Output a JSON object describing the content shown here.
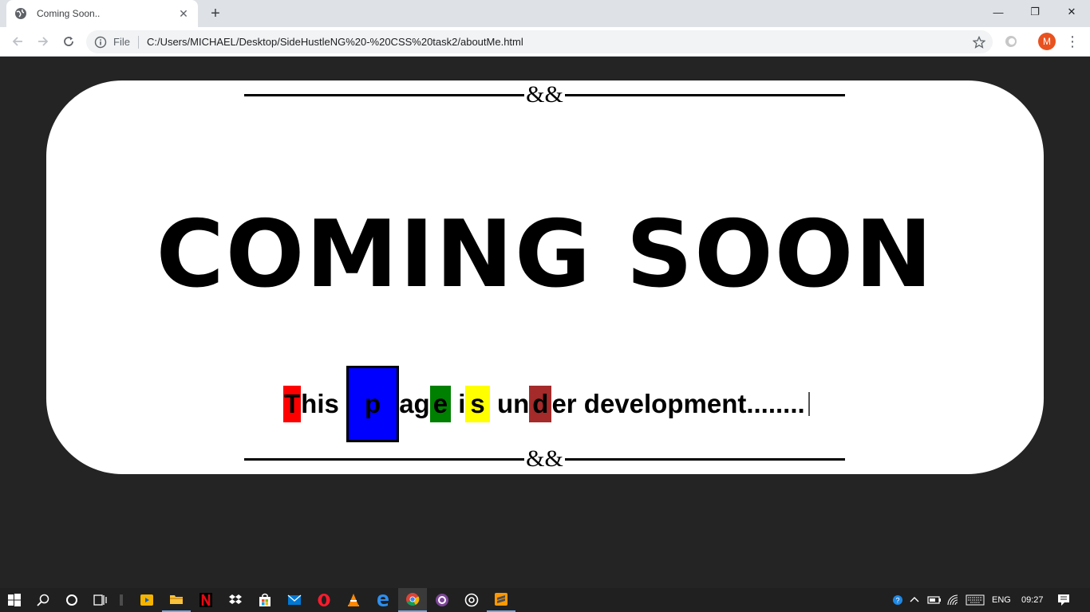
{
  "browser": {
    "tab_title": "Coming Soon..",
    "tab_close": "✕",
    "new_tab": "+",
    "scheme_label": "File",
    "url": "C:/Users/MICHAEL/Desktop/SideHustleNG%20-%20CSS%20task2/aboutMe.html",
    "avatar_letter": "M",
    "window_minimize": "—",
    "window_restore": "❐",
    "window_close": "✕"
  },
  "page": {
    "divider_symbol": "&&",
    "headline": "COMING SOON",
    "subline": {
      "t": "T",
      "his": "his ",
      "p": "p",
      "ag": "ag",
      "e": "e",
      "i": " i",
      "s": "s",
      "un": " un",
      "d": "d",
      "rest": "er development........"
    }
  },
  "taskbar": {
    "language": "ENG",
    "time": "09:27"
  },
  "colors": {
    "page_bg": "#242424",
    "card_bg": "#ffffff",
    "highlight_red": "#ff0000",
    "highlight_blue": "#0000ff",
    "highlight_green": "#008000",
    "highlight_yellow": "#ffff00",
    "highlight_brown": "#a52a2a",
    "avatar": "#e8521f"
  },
  "icons": [
    "globe-icon",
    "back-arrow-icon",
    "forward-arrow-icon",
    "reload-icon",
    "info-icon",
    "star-icon",
    "extension-icon",
    "kebab-menu-icon",
    "windows-start-icon",
    "search-icon",
    "cortana-icon",
    "task-view-icon"
  ]
}
